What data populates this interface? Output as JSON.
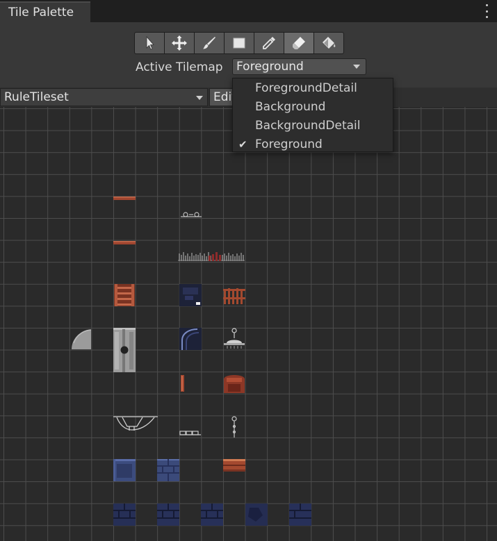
{
  "window": {
    "tab_title": "Tile Palette"
  },
  "toolbar": {
    "tools": [
      {
        "name": "select-tool",
        "icon": "arrow-cursor-icon",
        "active": false
      },
      {
        "name": "move-tool",
        "icon": "move-arrows-icon",
        "active": false
      },
      {
        "name": "paint-tool",
        "icon": "brush-icon",
        "active": false
      },
      {
        "name": "box-fill-tool",
        "icon": "rectangle-icon",
        "active": false
      },
      {
        "name": "picker-tool",
        "icon": "eyedropper-icon",
        "active": false
      },
      {
        "name": "eraser-tool",
        "icon": "eraser-icon",
        "active": true
      },
      {
        "name": "fill-tool",
        "icon": "paint-bucket-icon",
        "active": false
      }
    ]
  },
  "active_tilemap": {
    "label": "Active Tilemap",
    "value": "Foreground",
    "options": [
      {
        "label": "ForegroundDetail",
        "checked": false
      },
      {
        "label": "Background",
        "checked": false
      },
      {
        "label": "BackgroundDetail",
        "checked": false
      },
      {
        "label": "Foreground",
        "checked": true
      }
    ]
  },
  "palette": {
    "value": "RuleTileset",
    "edit_label": "Edit"
  },
  "colors": {
    "background": "#2b2b2b",
    "grid_line": "#4d4d4d",
    "toolbar": "#383838",
    "wood": "#a0452f",
    "stone": "#8f8f8f",
    "blue_tile": "#34406a"
  }
}
